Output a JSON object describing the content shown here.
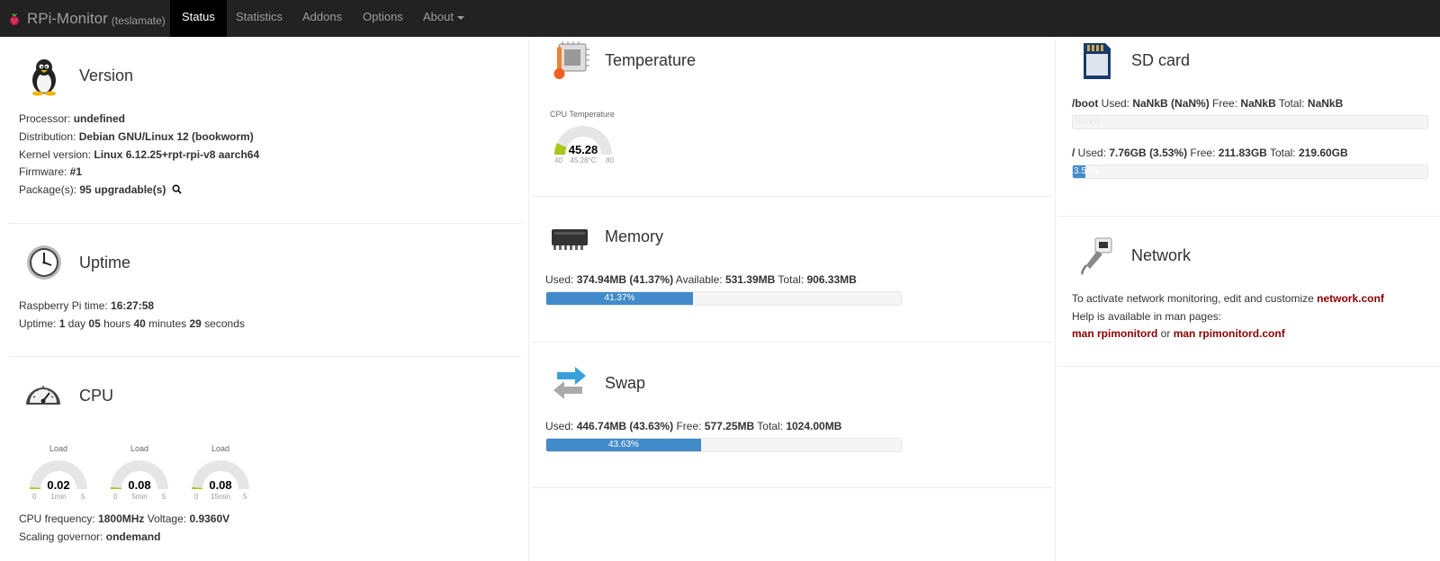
{
  "nav": {
    "brand": "RPi-Monitor",
    "host": "(teslamate)",
    "items": [
      "Status",
      "Statistics",
      "Addons",
      "Options",
      "About"
    ]
  },
  "version": {
    "title": "Version",
    "processor_label": "Processor: ",
    "processor": "undefined",
    "distribution_label": "Distribution: ",
    "distribution": "Debian GNU/Linux 12 (bookworm)",
    "kernel_label": "Kernel version: ",
    "kernel": "Linux 6.12.25+rpt-rpi-v8 aarch64",
    "firmware_label": "Firmware: ",
    "firmware": "#1",
    "packages_label": "Package(s): ",
    "packages": "95 upgradable(s)"
  },
  "uptime": {
    "title": "Uptime",
    "pitime_label": "Raspberry Pi time: ",
    "pitime": "16:27:58",
    "uptime_label": "Uptime: ",
    "days": "1",
    "days_unit": " day ",
    "hours": "05",
    "hours_unit": " hours ",
    "minutes": "40",
    "minutes_unit": " minutes ",
    "seconds": "29",
    "seconds_unit": " seconds"
  },
  "cpu": {
    "title": "CPU",
    "gauges": [
      {
        "label": "Load",
        "value": "0.02",
        "sub": "1min",
        "min": "0",
        "max": "5",
        "level": 0.004
      },
      {
        "label": "Load",
        "value": "0.08",
        "sub": "5min",
        "min": "0",
        "max": "5",
        "level": 0.016
      },
      {
        "label": "Load",
        "value": "0.08",
        "sub": "15min",
        "min": "0",
        "max": "5",
        "level": 0.016
      }
    ],
    "freq_label": "CPU frequency: ",
    "freq": "1800MHz",
    "voltage_label": " Voltage: ",
    "voltage": "0.9360V",
    "governor_label": "Scaling governor: ",
    "governor": "ondemand"
  },
  "temperature": {
    "title": "Temperature",
    "gauge_label": "CPU Temperature",
    "value": "45.28",
    "sub": "45.28°C",
    "min": "40",
    "max": "80",
    "level": 0.132
  },
  "memory": {
    "title": "Memory",
    "used_label": "Used: ",
    "used": "374.94MB",
    "used_pct": "(41.37%)",
    "avail_label": " Available: ",
    "avail": "531.39MB",
    "total_label": " Total: ",
    "total": "906.33MB",
    "bar_text": "41.37%",
    "percent": 41.37
  },
  "swap": {
    "title": "Swap",
    "used_label": "Used: ",
    "used": "446.74MB",
    "used_pct": "(43.63%)",
    "free_label": " Free: ",
    "free": "577.25MB",
    "total_label": " Total: ",
    "total": "1024.00MB",
    "bar_text": "43.63%",
    "percent": 43.63
  },
  "sdcard": {
    "title": "SD card",
    "boot_mount": "/boot",
    "boot_used_label": " Used: ",
    "boot_used": "NaNkB",
    "boot_pct": "(NaN%)",
    "boot_free_label": " Free: ",
    "boot_free": "NaNkB",
    "boot_total_label": " Total: ",
    "boot_total": "NaNkB",
    "boot_bar_text": "NaN%",
    "root_mount": "/",
    "root_used_label": " Used: ",
    "root_used": "7.76GB",
    "root_pct": "(3.53%)",
    "root_free_label": " Free: ",
    "root_free": "211.83GB",
    "root_total_label": " Total: ",
    "root_total": "219.60GB",
    "root_bar_text": "3.53%",
    "root_percent": 3.53
  },
  "network": {
    "title": "Network",
    "line1": "To activate network monitoring, edit and customize ",
    "conf": "network.conf",
    "line2": "Help is available in man pages:",
    "man1": "man rpimonitord",
    "or": " or ",
    "man2": "man rpimonitord.conf"
  },
  "colors": {
    "navbar": "#222222",
    "accent": "#428bca",
    "link": "#8b0000",
    "gauge_fill": "#a5c81c"
  }
}
